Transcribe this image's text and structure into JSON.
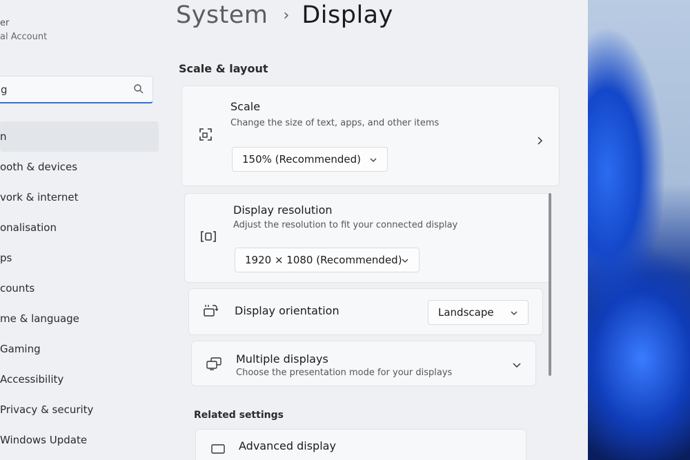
{
  "user": {
    "name": "er",
    "account_type": "al Account"
  },
  "search": {
    "value": "g",
    "placeholder": ""
  },
  "nav": [
    {
      "label": "n",
      "active": true
    },
    {
      "label": "ooth & devices"
    },
    {
      "label": "vork & internet"
    },
    {
      "label": "onalisation"
    },
    {
      "label": "ps"
    },
    {
      "label": "counts"
    },
    {
      "label": "me & language"
    },
    {
      "label": "Gaming"
    },
    {
      "label": "Accessibility"
    },
    {
      "label": "Privacy & security"
    },
    {
      "label": "Windows Update"
    }
  ],
  "breadcrumb": {
    "parent": "System",
    "separator": "›",
    "current": "Display"
  },
  "section": {
    "heading": "Scale & layout"
  },
  "scale": {
    "title": "Scale",
    "description": "Change the size of text, apps, and other items",
    "value": "150% (Recommended)"
  },
  "resolution": {
    "title": "Display resolution",
    "description": "Adjust the resolution to fit your connected display",
    "value": "1920 × 1080 (Recommended)"
  },
  "orientation": {
    "title": "Display orientation",
    "value": "Landscape"
  },
  "multiple": {
    "title": "Multiple displays",
    "description": "Choose the presentation mode for your displays"
  },
  "related": {
    "heading": "Related settings",
    "advanced_title": "Advanced display"
  },
  "colors": {
    "accent": "#2f6fd6",
    "window_bg": "#eef0f3",
    "card_bg": "#f7f8f9"
  }
}
